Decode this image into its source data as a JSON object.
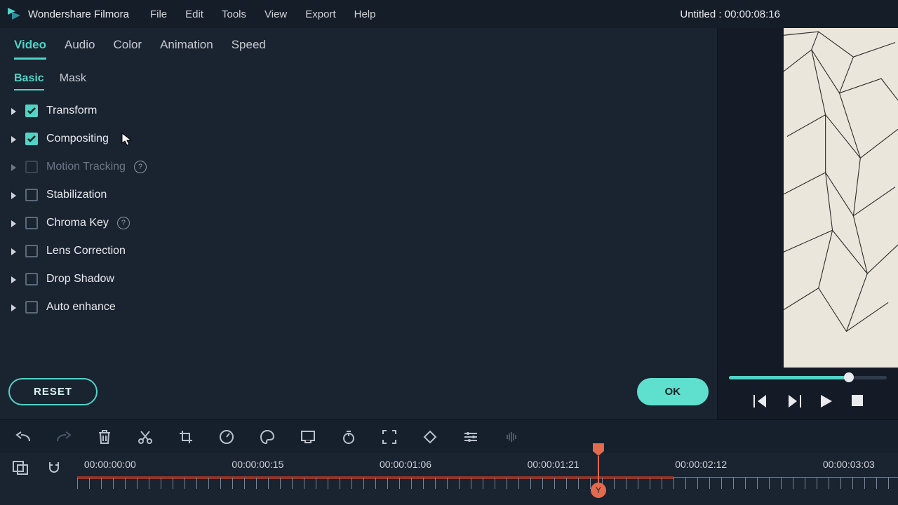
{
  "app": {
    "name": "Wondershare Filmora"
  },
  "menubar": {
    "items": [
      "File",
      "Edit",
      "Tools",
      "View",
      "Export",
      "Help"
    ]
  },
  "title_right": {
    "project": "Untitled",
    "sep": " : ",
    "time": "00:00:08:16"
  },
  "tabs_primary": {
    "items": [
      "Video",
      "Audio",
      "Color",
      "Animation",
      "Speed"
    ],
    "active": 0
  },
  "tabs_secondary": {
    "items": [
      "Basic",
      "Mask"
    ],
    "active": 0
  },
  "props": [
    {
      "label": "Transform",
      "checked": true,
      "disabled": false,
      "help": false
    },
    {
      "label": "Compositing",
      "checked": true,
      "disabled": false,
      "help": false
    },
    {
      "label": "Motion Tracking",
      "checked": false,
      "disabled": true,
      "help": true
    },
    {
      "label": "Stabilization",
      "checked": false,
      "disabled": false,
      "help": false
    },
    {
      "label": "Chroma Key",
      "checked": false,
      "disabled": false,
      "help": true
    },
    {
      "label": "Lens Correction",
      "checked": false,
      "disabled": false,
      "help": false
    },
    {
      "label": "Drop Shadow",
      "checked": false,
      "disabled": false,
      "help": false
    },
    {
      "label": "Auto enhance",
      "checked": false,
      "disabled": false,
      "help": false
    }
  ],
  "buttons": {
    "reset": "RESET",
    "ok": "OK"
  },
  "preview": {
    "progress_pct": 76
  },
  "timeline": {
    "labels": [
      {
        "text": "00:00:00:00",
        "pct": 4
      },
      {
        "text": "00:00:00:15",
        "pct": 22
      },
      {
        "text": "00:00:01:06",
        "pct": 40
      },
      {
        "text": "00:00:01:21",
        "pct": 58
      },
      {
        "text": "00:00:02:12",
        "pct": 76
      },
      {
        "text": "00:00:03:03",
        "pct": 94
      }
    ],
    "playhead_pct": 63.5,
    "playhead_badge": "Y"
  },
  "help_glyph": "?"
}
